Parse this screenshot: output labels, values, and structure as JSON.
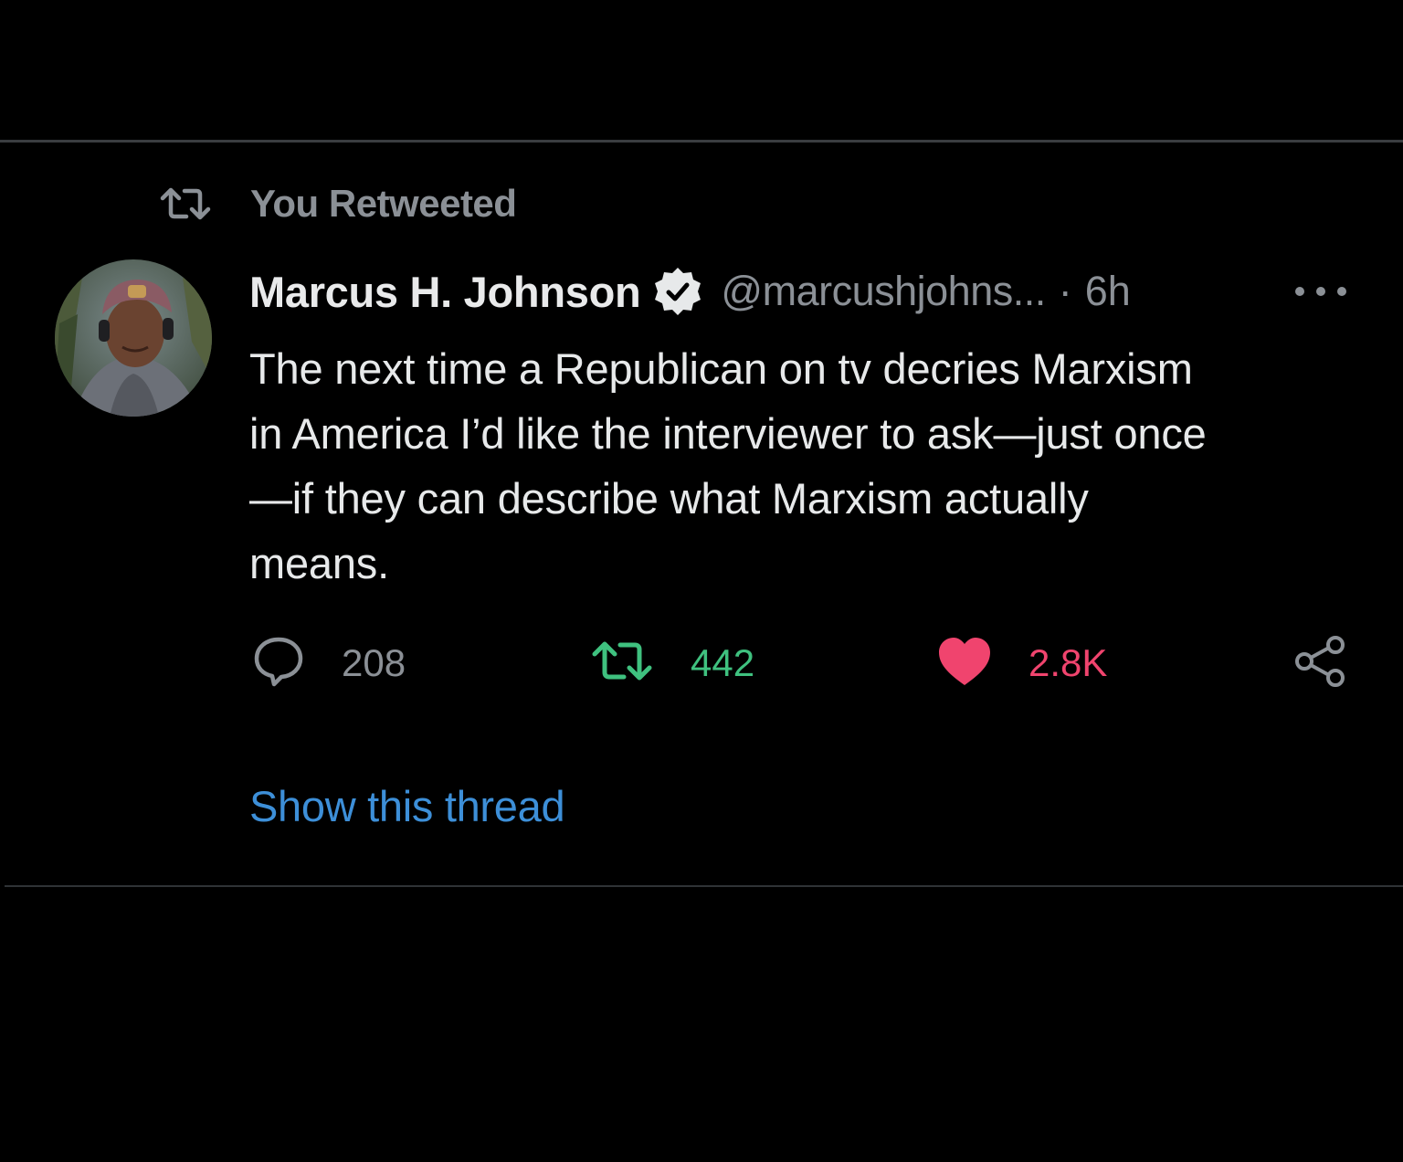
{
  "retweet_context": {
    "label": "You Retweeted",
    "icon": "retweet-icon"
  },
  "tweet": {
    "display_name": "Marcus H. Johnson",
    "verified_icon": "verified-badge-icon",
    "handle": "@marcushjohns...",
    "separator": "·",
    "time": "6h",
    "text_lines": [
      "The next time a Republican on tv decries Marxism",
      "in America I’d like the interviewer to ask—just once",
      "—if they can describe what Marxism actually",
      "means."
    ],
    "more_icon": "more-options-icon"
  },
  "actions": {
    "reply": {
      "icon": "reply-icon",
      "count": "208"
    },
    "retweet": {
      "icon": "retweet-icon",
      "count": "442",
      "active": true
    },
    "like": {
      "icon": "heart-icon",
      "count": "2.8K",
      "active": true
    },
    "share": {
      "icon": "share-icon"
    }
  },
  "show_thread": "Show this thread",
  "colors": {
    "background": "#000000",
    "muted": "#8b9096",
    "retweet_green": "#3fc17f",
    "like_pink": "#f0446e",
    "link_blue": "#3d8fd8"
  }
}
